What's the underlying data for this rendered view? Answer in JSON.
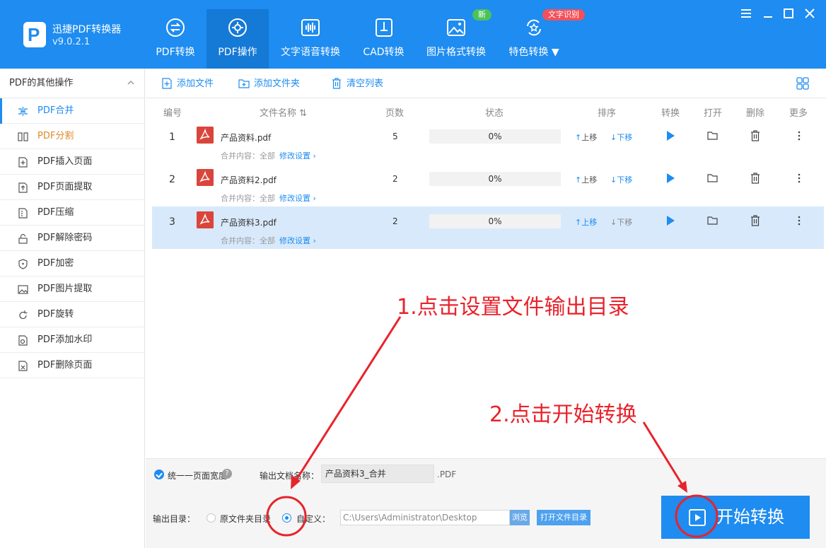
{
  "app": {
    "name": "迅捷PDF转换器",
    "version": "v9.0.2.1",
    "logo_letter": "P"
  },
  "nav": [
    {
      "label": "PDF转换",
      "icon": "swap-icon"
    },
    {
      "label": "PDF操作",
      "icon": "gear-icon",
      "active": true
    },
    {
      "label": "文字语音转换",
      "icon": "audio-wave-icon"
    },
    {
      "label": "CAD转换",
      "icon": "cad-icon"
    },
    {
      "label": "图片格式转换",
      "icon": "image-icon",
      "badge": "新"
    },
    {
      "label": "特色转换",
      "icon": "star-refresh-icon",
      "badge": "文字识别"
    }
  ],
  "sidebar": {
    "title": "PDF的其他操作",
    "items": [
      {
        "label": "PDF合并",
        "icon": "merge-icon"
      },
      {
        "label": "PDF分割",
        "icon": "split-icon"
      },
      {
        "label": "PDF插入页面",
        "icon": "insert-page-icon"
      },
      {
        "label": "PDF页面提取",
        "icon": "extract-page-icon"
      },
      {
        "label": "PDF压缩",
        "icon": "compress-icon"
      },
      {
        "label": "PDF解除密码",
        "icon": "unlock-icon"
      },
      {
        "label": "PDF加密",
        "icon": "shield-icon"
      },
      {
        "label": "PDF图片提取",
        "icon": "image-extract-icon"
      },
      {
        "label": "PDF旋转",
        "icon": "rotate-icon"
      },
      {
        "label": "PDF添加水印",
        "icon": "watermark-icon"
      },
      {
        "label": "PDF删除页面",
        "icon": "delete-page-icon"
      }
    ]
  },
  "toolbar": {
    "add_file": "添加文件",
    "add_folder": "添加文件夹",
    "clear_list": "清空列表"
  },
  "table": {
    "headers": {
      "num": "编号",
      "name": "文件名称",
      "pages": "页数",
      "status": "状态",
      "sort": "排序",
      "convert": "转换",
      "open": "打开",
      "delete": "删除",
      "more": "更多"
    },
    "up_label": "上移",
    "down_label": "下移",
    "rows": [
      {
        "num": "1",
        "name": "产品资料.pdf",
        "pages": "5",
        "progress": "0%",
        "merge_label": "合并内容：全部",
        "edit_label": "修改设置 ›"
      },
      {
        "num": "2",
        "name": "产品资料2.pdf",
        "pages": "2",
        "progress": "0%",
        "merge_label": "合并内容：全部",
        "edit_label": "修改设置 ›"
      },
      {
        "num": "3",
        "name": "产品资料3.pdf",
        "pages": "2",
        "progress": "0%",
        "merge_label": "合并内容：全部",
        "edit_label": "修改设置 ›"
      }
    ]
  },
  "annotations": {
    "step1": "1.点击设置文件输出目录",
    "step2": "2.点击开始转换"
  },
  "bottom": {
    "unify_width": "统一一页面宽度",
    "help_mark": "?",
    "output_name_label": "输出文档名称：",
    "output_name_value": "产品资料3_合并",
    "ext": ".PDF",
    "output_dir_label": "输出目录：",
    "orig_dir": "原文件夹目录",
    "custom": "自定义：",
    "path": "C:\\Users\\Administrator\\Desktop",
    "browse": "浏览",
    "open_dir": "打开文件目录",
    "start": "开始转换"
  },
  "colors": {
    "brand": "#1e8cf0",
    "annotation": "#e8232b",
    "pdf_icon": "#d9453c",
    "selected_row": "#d8e9fb"
  }
}
